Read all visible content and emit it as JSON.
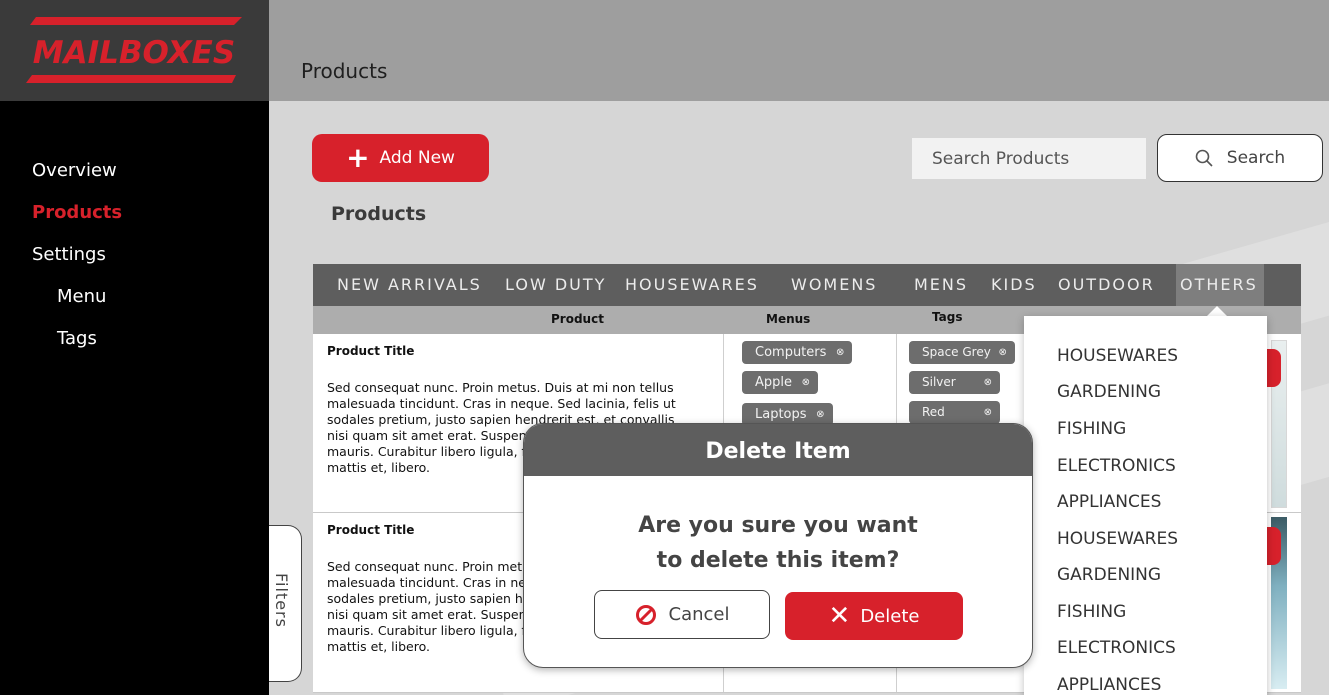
{
  "brand": {
    "logo_text": "MAILBOXES",
    "accent_color": "#d7212b"
  },
  "sidebar": {
    "items": [
      {
        "label": "Overview",
        "active": false
      },
      {
        "label": "Products",
        "active": true
      },
      {
        "label": "Settings",
        "active": false
      },
      {
        "label": "Menu",
        "active": false
      },
      {
        "label": "Tags",
        "active": false
      }
    ]
  },
  "header": {
    "title": "Products"
  },
  "toolbar": {
    "add_label": "Add New",
    "search_placeholder": "Search Products",
    "search_label": "Search"
  },
  "section_title": "Products",
  "categories": [
    {
      "label": "NEW ARRIVALS"
    },
    {
      "label": "LOW DUTY"
    },
    {
      "label": "HOUSEWARES"
    },
    {
      "label": "WOMENS"
    },
    {
      "label": "MENS"
    },
    {
      "label": "KIDS"
    },
    {
      "label": "OUTDOOR"
    },
    {
      "label": "OTHERS",
      "active": true
    }
  ],
  "table": {
    "headers": {
      "product": "Product",
      "menus": "Menus",
      "tags": "Tags"
    },
    "rows": [
      {
        "title": "Product Title",
        "description": "Sed consequat nunc. Proin metus. Duis at mi non tellus malesuada tincidunt. Cras in neque. Sed lacinia, felis ut sodales pretium, justo sapien hendrerit est, et convallis nisi quam sit amet erat. Suspendisse consequat nibh a mauris. Curabitur libero ligula, faucibus at, mollis ornare, mattis et, libero.",
        "menus": [
          "Computers",
          "Apple",
          "Laptops"
        ],
        "tags": [
          "Space Grey",
          "Silver",
          "Red"
        ]
      },
      {
        "title": "Product Title",
        "description": "Sed consequat nunc. Proin metus. Duis at mi non tellus malesuada tincidunt. Cras in neque. Sed lacinia, felis ut sodales pretium, justo sapien hendrerit est, et convallis nisi quam sit amet erat. Suspendisse consequat nibh a mauris. Curabitur libero ligula, faucibus at, mollis ornare, mattis et, libero.",
        "menus": [],
        "tags": []
      }
    ]
  },
  "dropdown": {
    "items": [
      "HOUSEWARES",
      "GARDENING",
      "FISHING",
      "ELECTRONICS",
      "APPLIANCES",
      "HOUSEWARES",
      "GARDENING",
      "FISHING",
      "ELECTRONICS",
      "APPLIANCES"
    ]
  },
  "filters_label": "Filters",
  "modal": {
    "title": "Delete Item",
    "message_line1": "Are you sure you want",
    "message_line2": "to delete this item?",
    "cancel_label": "Cancel",
    "delete_label": "Delete"
  }
}
